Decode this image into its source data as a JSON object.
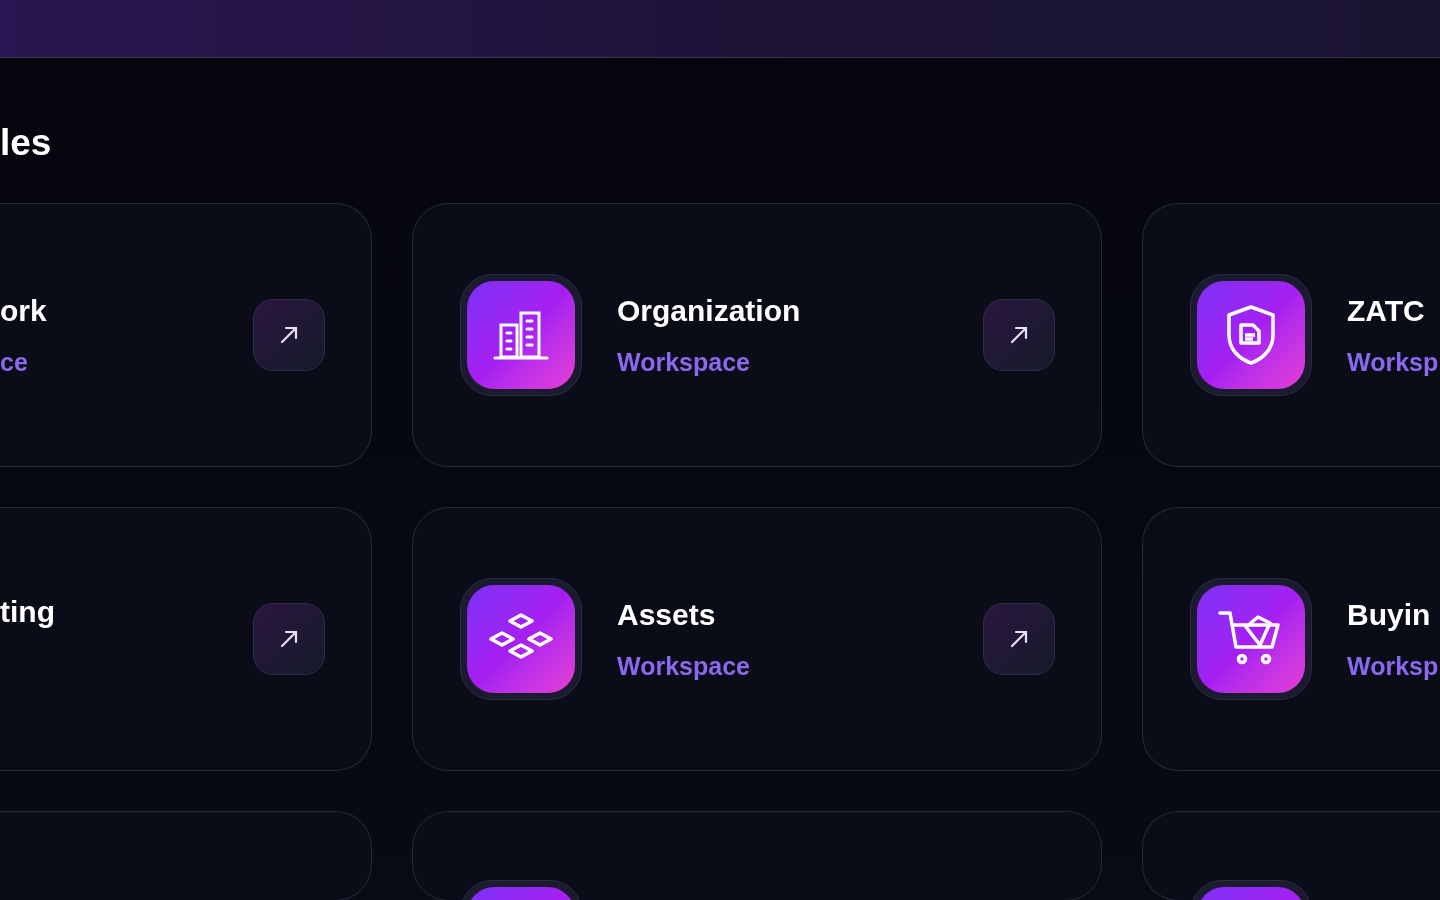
{
  "section_title": "les",
  "rows": [
    [
      {
        "kind": "full",
        "title": "ork",
        "subtitle": "ce"
      },
      {
        "kind": "full",
        "title": "Organization",
        "subtitle": "Workspace"
      },
      {
        "kind": "full",
        "title": "ZATC",
        "subtitle": "Worksp"
      }
    ],
    [
      {
        "kind": "full",
        "title": "ting"
      },
      {
        "kind": "full",
        "title": "Assets",
        "subtitle": "Workspace"
      },
      {
        "kind": "full",
        "title": "Buyin",
        "subtitle": "Worksp"
      }
    ],
    [
      {
        "kind": "cut"
      },
      {
        "kind": "cut"
      },
      {
        "kind": "cut"
      }
    ]
  ]
}
